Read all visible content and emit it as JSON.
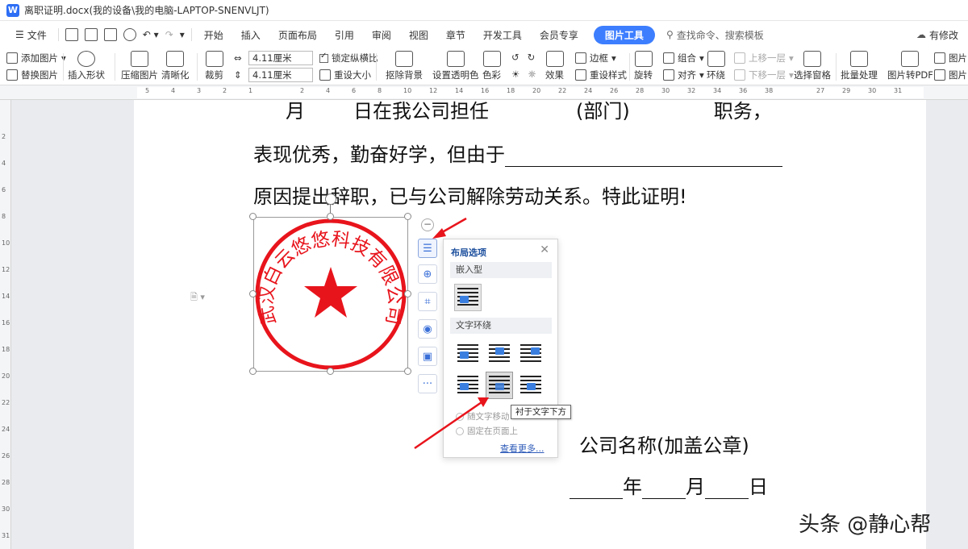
{
  "window": {
    "title": "离职证明.docx(我的设备\\我的电脑-LAPTOP-SNENVLJT)",
    "app_badge": "W"
  },
  "menu": {
    "file": "文件",
    "tabs": [
      "开始",
      "插入",
      "页面布局",
      "引用",
      "审阅",
      "视图",
      "章节",
      "开发工具",
      "会员专享"
    ],
    "active_tab": "图片工具",
    "search_placeholder": "查找命令、搜索模板",
    "status": "有修改"
  },
  "ribbon": {
    "add_picture": "添加图片",
    "replace_picture": "替换图片",
    "insert_shape": "插入形状",
    "compress_picture": "压缩图片",
    "sharpen": "清晰化",
    "crop": "裁剪",
    "width": "4.11厘米",
    "height": "4.11厘米",
    "lock_ratio": "锁定纵横比",
    "reset_size": "重设大小",
    "remove_bg": "抠除背景",
    "set_transparent": "设置透明色",
    "color": "色彩",
    "effect": "效果",
    "border": "边框",
    "reset_style": "重设样式",
    "rotate": "旋转",
    "group": "组合",
    "align": "对齐",
    "bring_forward": "上移一层",
    "send_backward": "下移一层",
    "wrap": "环绕",
    "select_pane": "选择窗格",
    "batch": "批量处理",
    "to_pdf": "图片转PDF",
    "pic_more_1": "图片",
    "pic_more_2": "图片"
  },
  "ruler": {
    "h_ticks": [
      "5",
      "4",
      "3",
      "2",
      "1",
      "",
      "2",
      "4",
      "6",
      "8",
      "10",
      "12",
      "14",
      "16",
      "18",
      "20",
      "22",
      "24",
      "26",
      "28",
      "30",
      "32",
      "34",
      "36",
      "38",
      "",
      "27",
      "29",
      "30",
      "31"
    ],
    "v_ticks": [
      "",
      "2",
      "4",
      "6",
      "8",
      "10",
      "12",
      "14",
      "16",
      "18",
      "20",
      "22",
      "24",
      "26",
      "28",
      "30",
      "31"
    ]
  },
  "document": {
    "line1_a": "月",
    "line1_b": "日在我公司担任",
    "line1_c": "(部门)",
    "line1_d": "职务，",
    "line2": "表现优秀，勤奋好学，但由于",
    "line3": "原因提出辞职，已与公司解除劳动关系。特此证明!",
    "company": "公司名称(加盖公章)",
    "date_year": "年",
    "date_month": "月",
    "date_day": "日"
  },
  "stamp": {
    "text": "武汉白云悠悠科技有限公司",
    "color": "#e8141c"
  },
  "layout_popup": {
    "title": "布局选项",
    "inline_section": "嵌入型",
    "wrap_section": "文字环绕",
    "move_with_text": "随文字移动",
    "fix_on_page": "固定在页面上",
    "see_more": "查看更多...",
    "tooltip": "衬于文字下方"
  },
  "watermark": "头条 @静心帮",
  "colors": {
    "accent": "#3d7eff",
    "arrow": "#e8141c",
    "stamp": "#e8141c"
  }
}
